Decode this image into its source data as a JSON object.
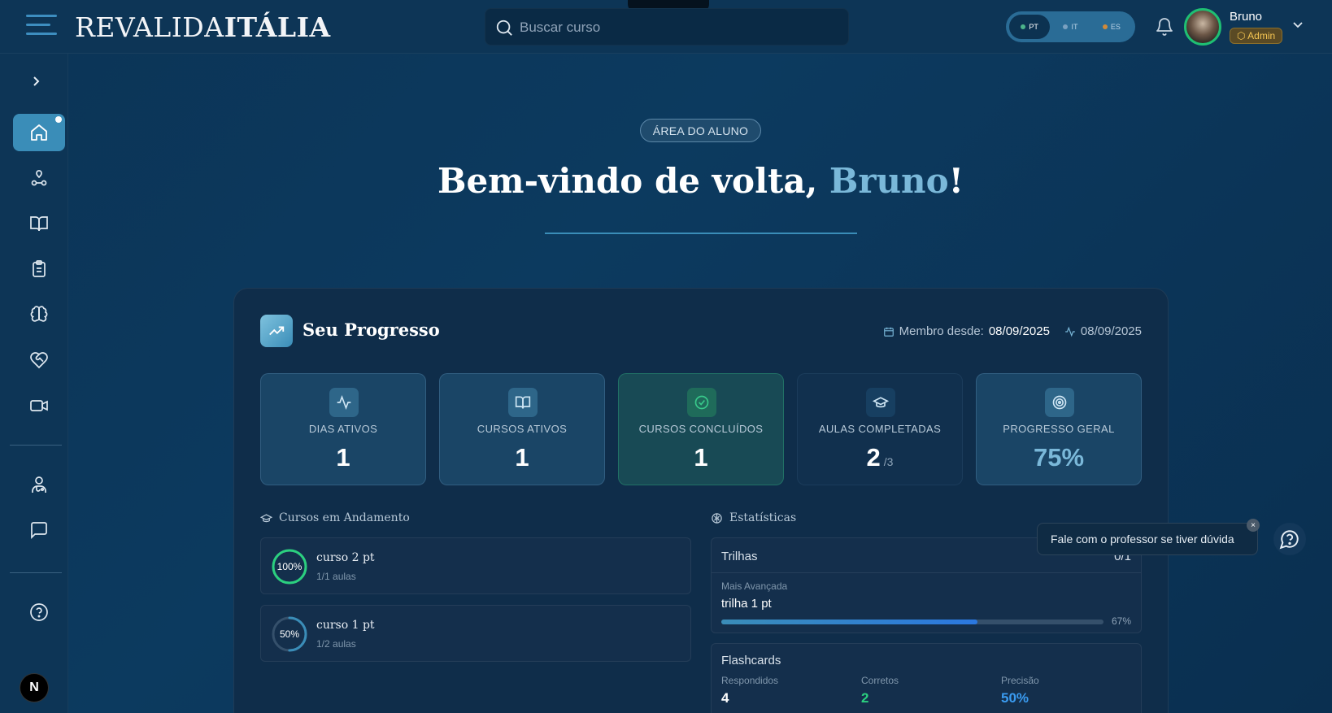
{
  "header": {
    "logo_light": "REVALIDA",
    "logo_bold": "ITÁLIA",
    "search_placeholder": "Buscar curso",
    "languages": [
      {
        "code": "PT",
        "dot_color": "#4cb38a",
        "active": true
      },
      {
        "code": "IT",
        "dot_color": "#7aa0c0",
        "active": false
      },
      {
        "code": "ES",
        "dot_color": "#d08a3a",
        "active": false
      }
    ],
    "user_name": "Bruno",
    "user_role": "Admin"
  },
  "sidebar": {
    "items": [
      {
        "name": "home",
        "icon": "home-icon",
        "active": true
      },
      {
        "name": "trails",
        "icon": "route-icon"
      },
      {
        "name": "courses",
        "icon": "book-icon"
      },
      {
        "name": "assessments",
        "icon": "clipboard-icon"
      },
      {
        "name": "flashcards",
        "icon": "brain-icon"
      },
      {
        "name": "support",
        "icon": "heart-handshake-icon"
      },
      {
        "name": "live",
        "icon": "video-icon"
      },
      {
        "name": "profile",
        "icon": "doctor-icon"
      },
      {
        "name": "messages",
        "icon": "message-icon"
      },
      {
        "name": "help",
        "icon": "help-icon"
      }
    ],
    "bottom_badge": "N"
  },
  "hero": {
    "pill": "ÁREA DO ALUNO",
    "title_prefix": "Bem-vindo de volta, ",
    "title_name": "Bruno",
    "title_suffix": "!"
  },
  "progress": {
    "title": "Seu Progresso",
    "member_label": "Membro desde:",
    "member_date": "08/09/2025",
    "activity_date": "08/09/2025",
    "stats": [
      {
        "label": "DIAS ATIVOS",
        "value": "1",
        "suffix": "",
        "icon": "activity-icon",
        "accent": "#6fb5d8"
      },
      {
        "label": "CURSOS ATIVOS",
        "value": "1",
        "suffix": "",
        "icon": "book-open-icon",
        "accent": "#6fb5d8"
      },
      {
        "label": "CURSOS CONCLUÍDOS",
        "value": "1",
        "suffix": "",
        "icon": "check-circle-icon",
        "accent": "#38c98a"
      },
      {
        "label": "AULAS COMPLETADAS",
        "value": "2",
        "suffix": "/3",
        "icon": "graduation-cap-icon",
        "accent": "#6fb5d8"
      },
      {
        "label": "PROGRESSO GERAL",
        "value": "75%",
        "suffix": "",
        "icon": "target-icon",
        "accent": "#6fb5d8"
      }
    ],
    "courses_section": "Cursos em Andamento",
    "courses": [
      {
        "name": "curso 2 pt",
        "lessons": "1/1 aulas",
        "percent": "100%",
        "progress": 1.0,
        "color": "#2bd07f"
      },
      {
        "name": "curso 1 pt",
        "lessons": "1/2 aulas",
        "percent": "50%",
        "progress": 0.5,
        "color": "#3a8db8"
      }
    ],
    "stats_section": "Estatísticas",
    "trilhas": {
      "title": "Trilhas",
      "count": "0/1",
      "most_advanced_label": "Mais Avançada",
      "most_advanced_name": "trilha 1 pt",
      "percent": "67%",
      "progress": 0.67
    },
    "flashcards": {
      "title": "Flashcards",
      "answered_label": "Respondidos",
      "answered": "4",
      "correct_label": "Corretos",
      "correct": "2",
      "precision_label": "Precisão",
      "precision": "50%"
    }
  },
  "help": {
    "tooltip": "Fale com o professor se tiver dúvida",
    "close": "×"
  }
}
